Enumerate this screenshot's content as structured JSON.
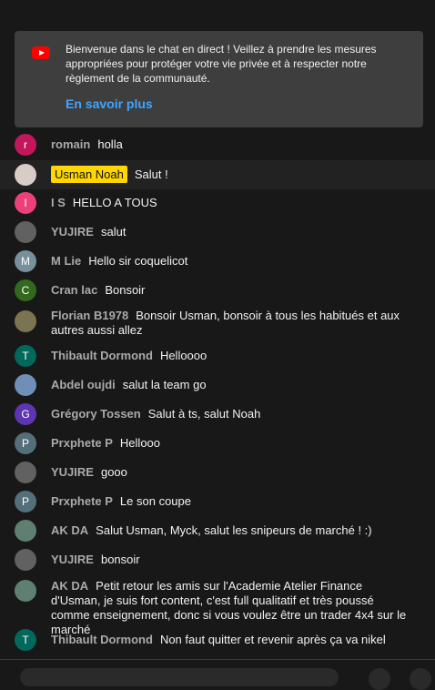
{
  "banner": {
    "text": "Bienvenue dans le chat en direct ! Veillez à prendre les mesures appropriées pour protéger votre vie privée et à respecter notre règlement de la communauté.",
    "link": "En savoir plus"
  },
  "colors": {
    "link": "#3ea6ff",
    "owner_badge": "#ffd600",
    "background": "#181818"
  },
  "messages": [
    {
      "author": "romain",
      "text": "holla",
      "avatar_letter": "r",
      "avatar_color": "#c2185b"
    },
    {
      "author": "Usman Noah",
      "text": "Salut !",
      "avatar_letter": "",
      "avatar_color": "#d7ccc8",
      "owner": true
    },
    {
      "author": "I S",
      "text": "HELLO A TOUS",
      "avatar_letter": "I",
      "avatar_color": "#ec407a"
    },
    {
      "author": "YUJIRE",
      "text": "salut",
      "avatar_letter": "",
      "avatar_color": "#616161"
    },
    {
      "author": "M Lie",
      "text": "Hello sir coquelicot",
      "avatar_letter": "M",
      "avatar_color": "#78909c"
    },
    {
      "author": "Cran lac",
      "text": "Bonsoir",
      "avatar_letter": "C",
      "avatar_color": "#33691e"
    },
    {
      "author": "Florian B1978",
      "text": "Bonsoir Usman, bonsoir à tous les habitués et aux autres aussi allez",
      "avatar_letter": "",
      "avatar_color": "#7a7450"
    },
    {
      "author": "Thibault Dormond",
      "text": "Helloooo",
      "avatar_letter": "T",
      "avatar_color": "#00695c"
    },
    {
      "author": "Abdel oujdi",
      "text": "salut la team go",
      "avatar_letter": "",
      "avatar_color": "#6f8fb8"
    },
    {
      "author": "Grégory Tossen",
      "text": "Salut à ts, salut Noah",
      "avatar_letter": "G",
      "avatar_color": "#5e35b1"
    },
    {
      "author": "Prxphete P",
      "text": "Hellooo",
      "avatar_letter": "P",
      "avatar_color": "#546e7a"
    },
    {
      "author": "YUJIRE",
      "text": "gooo",
      "avatar_letter": "",
      "avatar_color": "#616161"
    },
    {
      "author": "Prxphete P",
      "text": "Le son coupe",
      "avatar_letter": "P",
      "avatar_color": "#546e7a"
    },
    {
      "author": "AK DA",
      "text": "Salut Usman, Myck, salut les snipeurs de marché ! :)",
      "avatar_letter": "",
      "avatar_color": "#5f7f72"
    },
    {
      "author": "YUJIRE",
      "text": "bonsoir",
      "avatar_letter": "",
      "avatar_color": "#616161"
    },
    {
      "author": "AK DA",
      "text": "Petit retour les amis sur l'Academie Atelier Finance d'Usman, je suis fort content, c'est full qualitatif et très poussé comme enseignement, donc si vous voulez être un trader 4x4 sur le marché",
      "avatar_letter": "",
      "avatar_color": "#5f7f72"
    },
    {
      "author": "Thibault Dormond",
      "text": "Non faut quitter et revenir après ça va nikel",
      "avatar_letter": "T",
      "avatar_color": "#00695c"
    }
  ]
}
